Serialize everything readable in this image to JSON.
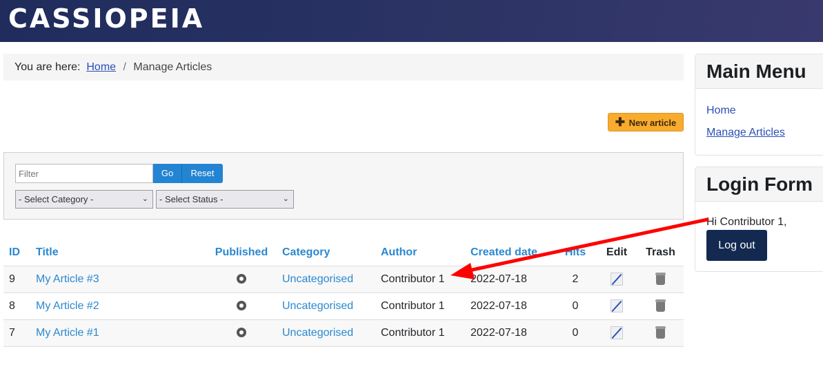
{
  "header": {
    "brand": "CASSIOPEIA"
  },
  "breadcrumb": {
    "prefix": "You are here:",
    "home": "Home",
    "separator": "/",
    "current": "Manage Articles"
  },
  "toolbar": {
    "new_article_label": "New article",
    "new_article_icon": "plus-icon"
  },
  "filters": {
    "filter_placeholder": "Filter",
    "filter_value": "",
    "go_label": "Go",
    "reset_label": "Reset",
    "category_select": "- Select Category -",
    "status_select": "- Select Status -"
  },
  "table": {
    "headers": [
      "ID",
      "Title",
      "Published",
      "Category",
      "Author",
      "Created date",
      "Hits",
      "Edit",
      "Trash"
    ],
    "rows": [
      {
        "id": "9",
        "title": "My Article #3",
        "published": "published-icon",
        "category": "Uncategorised",
        "author": "Contributor 1",
        "created": "2022-07-18",
        "hits": "2"
      },
      {
        "id": "8",
        "title": "My Article #2",
        "published": "published-icon",
        "category": "Uncategorised",
        "author": "Contributor 1",
        "created": "2022-07-18",
        "hits": "0"
      },
      {
        "id": "7",
        "title": "My Article #1",
        "published": "published-icon",
        "category": "Uncategorised",
        "author": "Contributor 1",
        "created": "2022-07-18",
        "hits": "0"
      }
    ]
  },
  "sidebar": {
    "main_menu": {
      "title": "Main Menu",
      "items": [
        {
          "label": "Home"
        },
        {
          "label": "Manage Articles"
        }
      ]
    },
    "login_form": {
      "title": "Login Form",
      "greeting": "Hi Contributor 1,",
      "logout_label": "Log out"
    }
  },
  "annotation": {
    "type": "arrow",
    "color": "#ff0000"
  }
}
